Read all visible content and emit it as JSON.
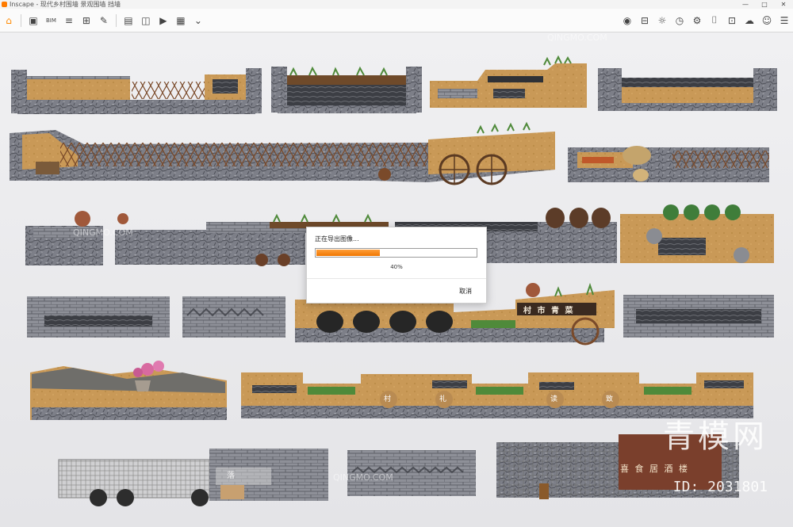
{
  "window": {
    "title": "Inscape - 现代乡村围墙 景观围墙 挡墙",
    "controls": [
      "—",
      "□",
      "✕"
    ]
  },
  "toolbar": {
    "bim_label": "BIM"
  },
  "dialog": {
    "message": "正在导出图像...",
    "progress_percent": 40,
    "progress_text": "40%",
    "cancel_label": "取消"
  },
  "canvas": {
    "signs": [
      "村 市 青 菜",
      "村",
      "礼",
      "读",
      "致",
      "喜 食 居 酒 楼",
      "落 "
    ],
    "watermark": "QINGMO.COM",
    "brand": "青模网",
    "id_label": "ID: 2031801"
  },
  "colors": {
    "accent": "#ff8a00",
    "progress": "#f07700"
  }
}
